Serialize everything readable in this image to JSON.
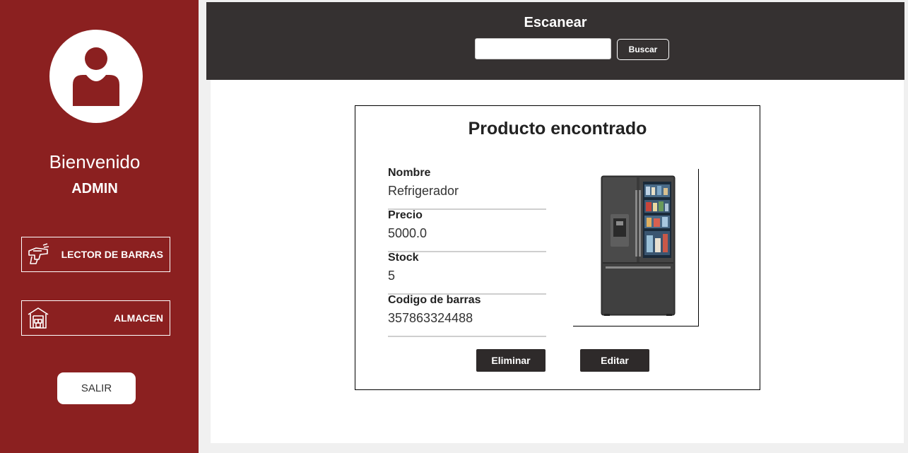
{
  "sidebar": {
    "welcome": "Bienvenido",
    "user": "ADMIN",
    "nav": [
      {
        "label": "LECTOR DE BARRAS",
        "icon": "barcode-scanner-icon"
      },
      {
        "label": "ALMACEN",
        "icon": "warehouse-icon"
      }
    ],
    "logout_label": "SALIR"
  },
  "header": {
    "title": "Escanear",
    "search_value": "",
    "search_button": "Buscar"
  },
  "product": {
    "title": "Producto encontrado",
    "fields": [
      {
        "label": "Nombre",
        "value": "Refrigerador"
      },
      {
        "label": "Precio",
        "value": "5000.0"
      },
      {
        "label": "Stock",
        "value": "5"
      },
      {
        "label": "Codigo de barras",
        "value": "357863324488"
      }
    ],
    "image": "refrigerator-image",
    "delete_button": "Eliminar",
    "edit_button": "Editar"
  },
  "colors": {
    "sidebar_bg": "#8b2020",
    "topbar_bg": "#353131",
    "button_dark": "#2e2a2a"
  }
}
